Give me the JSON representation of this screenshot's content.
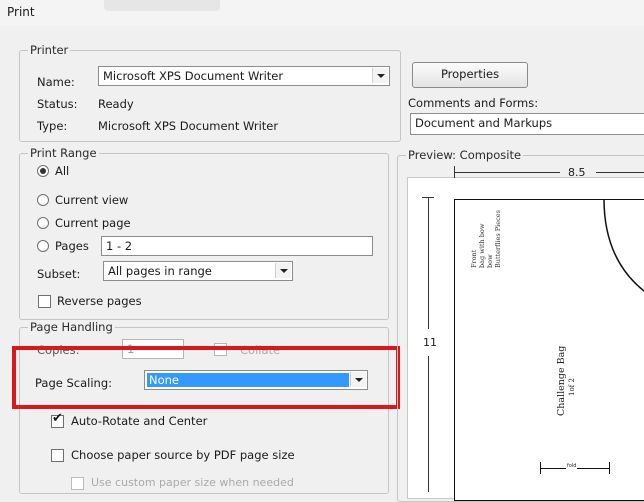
{
  "window": {
    "title": "Print"
  },
  "printer": {
    "group_label": "Printer",
    "name_label": "Name:",
    "name_value": "Microsoft XPS Document Writer",
    "status_label": "Status:",
    "status_value": "Ready",
    "type_label": "Type:",
    "type_value": "Microsoft XPS Document Writer",
    "properties_label": "Properties",
    "comments_label": "Comments and Forms:",
    "comments_value": "Document and Markups"
  },
  "print_range": {
    "group_label": "Print Range",
    "all_label": "All",
    "current_view_label": "Current view",
    "current_page_label": "Current page",
    "pages_label": "Pages",
    "pages_value": "1 - 2",
    "subset_label": "Subset:",
    "subset_value": "All pages in range",
    "reverse_label": "Reverse pages",
    "selected": "All"
  },
  "page_handling": {
    "group_label": "Page Handling",
    "copies_label": "Copies:",
    "copies_value": "1",
    "collate_label": "Collate",
    "scaling_label": "Page Scaling:",
    "scaling_value": "None",
    "auto_rotate_label": "Auto-Rotate and Center",
    "auto_rotate_checked": true,
    "paper_source_label": "Choose paper source by PDF page size",
    "paper_source_checked": false,
    "custom_paper_label": "Use custom paper size when needed"
  },
  "preview": {
    "group_label": "Preview: Composite",
    "width_label": "8.5",
    "height_label": "11",
    "page_title": "Challenge Bag",
    "page_subtitle": "1of 2",
    "side_text_1": "Front",
    "side_text_2": "bag with bow",
    "side_text_3": "bow",
    "side_text_4": "Butterflies Pieces",
    "bottom_tab": "fold"
  },
  "highlight": {
    "color": "#d9181e"
  },
  "colors": {
    "selection": "#3399ff"
  }
}
